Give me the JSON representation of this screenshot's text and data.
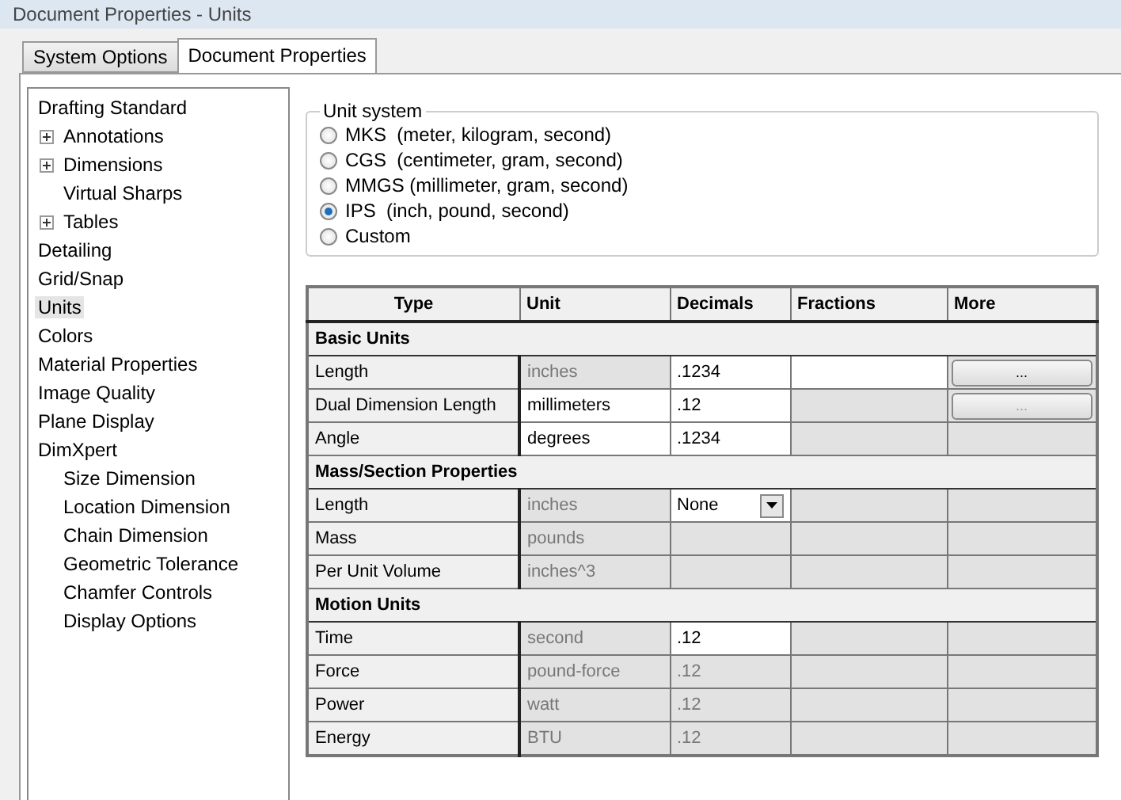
{
  "window": {
    "title": "Document Properties - Units"
  },
  "tabs": [
    {
      "label": "System Options",
      "selected": false
    },
    {
      "label": "Document Properties",
      "selected": true
    }
  ],
  "tree": [
    {
      "label": "Drafting Standard",
      "selected": false,
      "children": [
        {
          "label": "Annotations",
          "expanded": false,
          "selected": false
        },
        {
          "label": "Dimensions",
          "expanded": false,
          "selected": false
        },
        {
          "label": "Virtual Sharps",
          "selected": false
        },
        {
          "label": "Tables",
          "expanded": false,
          "selected": false
        }
      ]
    },
    {
      "label": "Detailing",
      "selected": false
    },
    {
      "label": "Grid/Snap",
      "selected": false
    },
    {
      "label": "Units",
      "selected": true
    },
    {
      "label": "Colors",
      "selected": false
    },
    {
      "label": "Material Properties",
      "selected": false
    },
    {
      "label": "Image Quality",
      "selected": false
    },
    {
      "label": "Plane Display",
      "selected": false
    },
    {
      "label": "DimXpert",
      "selected": false,
      "children": [
        {
          "label": "Size Dimension",
          "selected": false
        },
        {
          "label": "Location Dimension",
          "selected": false
        },
        {
          "label": "Chain Dimension",
          "selected": false
        },
        {
          "label": "Geometric Tolerance",
          "selected": false
        },
        {
          "label": "Chamfer Controls",
          "selected": false
        },
        {
          "label": "Display Options",
          "selected": false
        }
      ]
    }
  ],
  "unit_system": {
    "title": "Unit system",
    "options": [
      {
        "label": "MKS  (meter, kilogram, second)",
        "selected": false
      },
      {
        "label": "CGS  (centimeter, gram, second)",
        "selected": false
      },
      {
        "label": "MMGS (millimeter, gram, second)",
        "selected": false
      },
      {
        "label": "IPS  (inch, pound, second)",
        "selected": true
      },
      {
        "label": "Custom",
        "selected": false
      }
    ]
  },
  "table": {
    "columns": [
      "Type",
      "Unit",
      "Decimals",
      "Fractions",
      "More"
    ],
    "rows": [
      {
        "kind": "section",
        "label": "Basic Units"
      },
      {
        "kind": "unit",
        "type": "Length",
        "unit": {
          "text": "inches",
          "enabled": false
        },
        "decimals": {
          "kind": "field",
          "text": ".1234",
          "enabled": true
        },
        "fractions": {
          "enabled": true
        },
        "more": {
          "kind": "button",
          "label": "...",
          "enabled": true
        }
      },
      {
        "kind": "unit",
        "type": "Dual Dimension Length",
        "unit": {
          "text": "millimeters",
          "enabled": true
        },
        "decimals": {
          "kind": "field",
          "text": ".12",
          "enabled": true
        },
        "fractions": {
          "enabled": false
        },
        "more": {
          "kind": "button",
          "label": "...",
          "enabled": false
        }
      },
      {
        "kind": "unit",
        "type": "Angle",
        "unit": {
          "text": "degrees",
          "enabled": true
        },
        "decimals": {
          "kind": "field",
          "text": ".1234",
          "enabled": true
        },
        "fractions": {
          "enabled": false
        }
      },
      {
        "kind": "section",
        "label": "Mass/Section Properties"
      },
      {
        "kind": "unit",
        "type": "Length",
        "unit": {
          "text": "inches",
          "enabled": false
        },
        "decimals": {
          "kind": "dropdown",
          "text": "None",
          "enabled": true
        },
        "fractions": {
          "enabled": false
        }
      },
      {
        "kind": "unit",
        "type": "Mass",
        "unit": {
          "text": "pounds",
          "enabled": false
        },
        "fractions": {
          "enabled": false
        }
      },
      {
        "kind": "unit",
        "type": "Per Unit Volume",
        "unit": {
          "text": "inches^3",
          "enabled": false
        },
        "fractions": {
          "enabled": false
        }
      },
      {
        "kind": "section",
        "label": "Motion Units"
      },
      {
        "kind": "unit",
        "type": "Time",
        "unit": {
          "text": "second",
          "enabled": false
        },
        "decimals": {
          "kind": "field",
          "text": ".12",
          "enabled": true
        },
        "fractions": {
          "enabled": false
        }
      },
      {
        "kind": "unit",
        "type": "Force",
        "unit": {
          "text": "pound-force",
          "enabled": false
        },
        "decimals": {
          "kind": "field",
          "text": ".12",
          "enabled": false
        },
        "fractions": {
          "enabled": false
        }
      },
      {
        "kind": "unit",
        "type": "Power",
        "unit": {
          "text": "watt",
          "enabled": false
        },
        "decimals": {
          "kind": "field",
          "text": ".12",
          "enabled": false
        },
        "fractions": {
          "enabled": false
        }
      },
      {
        "kind": "unit",
        "type": "Energy",
        "unit": {
          "text": "BTU",
          "enabled": false
        },
        "decimals": {
          "kind": "field",
          "text": ".12",
          "enabled": false
        },
        "fractions": {
          "enabled": false
        }
      }
    ]
  }
}
